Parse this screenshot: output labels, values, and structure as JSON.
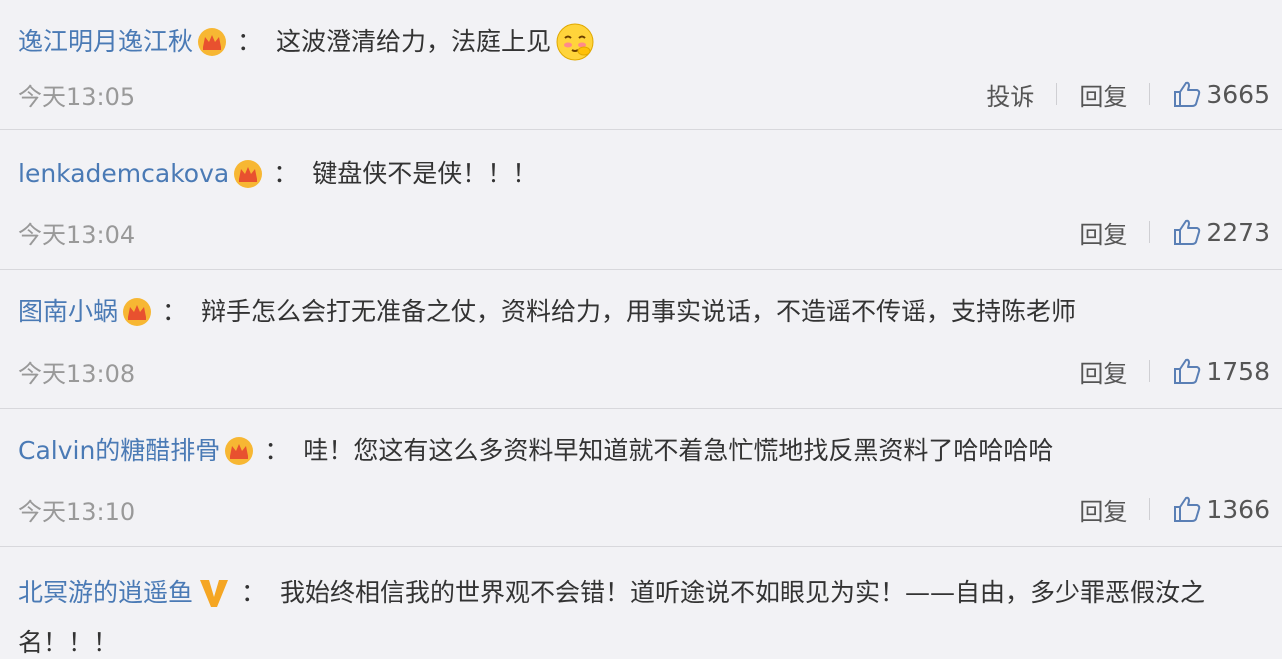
{
  "comments": [
    {
      "username": "逸江明月逸江秋",
      "colon": "：",
      "content": "这波澄清给力，法庭上见",
      "time": "今天13:05",
      "report_label": "投诉",
      "reply_label": "回复",
      "likes": "3665"
    },
    {
      "username": "lenkademcakova",
      "colon": "：",
      "content": "键盘侠不是侠！！！",
      "time": "今天13:04",
      "reply_label": "回复",
      "likes": "2273"
    },
    {
      "username": "图南小蜗",
      "colon": "：",
      "content": "辩手怎么会打无准备之仗，资料给力，用事实说话，不造谣不传谣，支持陈老师",
      "time": "今天13:08",
      "reply_label": "回复",
      "likes": "1758"
    },
    {
      "username": "Calvin的糖醋排骨",
      "colon": "：",
      "content": "哇！您这有这么多资料早知道就不着急忙慌地找反黑资料了哈哈哈哈",
      "time": "今天13:10",
      "reply_label": "回复",
      "likes": "1366"
    },
    {
      "username": "北冥游的逍遥鱼",
      "colon": "：",
      "content": "我始终相信我的世界观不会错！道听途说不如眼见为实！——自由，多少罪恶假汝之",
      "content_cont": "名！！！"
    }
  ],
  "colors": {
    "username": "#4a7ab5",
    "text": "#333333",
    "meta": "#999999",
    "background": "#f2f2f5",
    "crown": "#f5a623",
    "vbadge": "#f5a623"
  },
  "icons": {
    "crown": "crown-icon",
    "emoji": "blushing-emoji-icon",
    "thumb": "thumbs-up-icon",
    "verified": "verified-v-icon"
  }
}
